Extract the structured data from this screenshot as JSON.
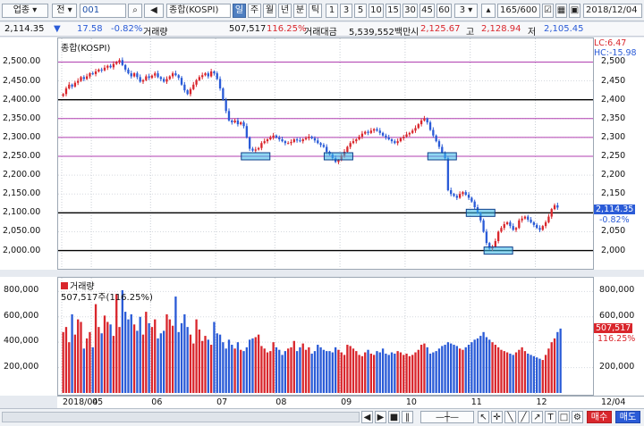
{
  "toolbar": {
    "market_select": "업종",
    "jeon_label": "전",
    "code_value": "001",
    "index_name": "종합(KOSPI)",
    "period_buttons": [
      "일",
      "주",
      "월",
      "년",
      "분",
      "틱"
    ],
    "interval_buttons": [
      "1",
      "3",
      "5",
      "10",
      "15",
      "30",
      "45",
      "60"
    ],
    "interval_select": "3",
    "count_value": "165/600",
    "date_value": "2018/12/04"
  },
  "quote": {
    "price": "2,114.35",
    "change": "17.58",
    "change_pct": "-0.82%",
    "volume_label": "거래량",
    "volume": "507,517",
    "volume_pct": "116.25%",
    "amount_label": "거래대금",
    "amount": "5,539,552백만",
    "open_label": "시",
    "open": "2,125.67",
    "high_label": "고",
    "high": "2,128.94",
    "low_label": "저",
    "low": "2,105.45"
  },
  "price_panel": {
    "title": "종합(KOSPI)",
    "lc": "LC:6.47",
    "hc": "HC:-15.98",
    "current_price": "2,114.35",
    "current_pct": "-0.82%",
    "y_ticks": [
      "2,500.00",
      "2,450.00",
      "2,400.00",
      "2,350.00",
      "2,300.00",
      "2,250.00",
      "2,200.00",
      "2,150.00",
      "2,100.00",
      "2,050.00",
      "2,000.00"
    ],
    "right_ticks": [
      "2,500",
      "2,450",
      "2,400",
      "2,350",
      "2,300",
      "2,250",
      "2,200",
      "2,150",
      "2,100",
      "2,050",
      "2,000"
    ]
  },
  "volume_panel": {
    "title": "거래량",
    "current_label": "507,517주(116.25%)",
    "current_value": "507,517",
    "current_pct": "116.25%",
    "y_ticks": [
      "800,000",
      "600,000",
      "400,000",
      "200,000"
    ],
    "right_ticks": [
      "800,000",
      "600,000",
      "400,000",
      "200,000"
    ]
  },
  "x_axis": {
    "labels": [
      "2018/04",
      "05",
      "06",
      "07",
      "08",
      "09",
      "10",
      "11",
      "12",
      "12/04"
    ]
  },
  "side_buttons": {
    "buy": "매수",
    "sell": "매도"
  },
  "colors": {
    "up": "#d9262c",
    "down": "#2a5bd7",
    "purple_line": "#b03fb0",
    "highlight": "#35b8e8"
  },
  "chart_data": {
    "type": "candlestick",
    "title": "종합(KOSPI)",
    "ylim": [
      1980,
      2520
    ],
    "reference_lines_black": [
      2400,
      2100,
      2000
    ],
    "reference_lines_purple": [
      2500,
      2350,
      2300,
      2250
    ],
    "highlight_levels": [
      2250,
      2250,
      2250,
      2100,
      2000
    ],
    "closes": [
      2415,
      2430,
      2440,
      2435,
      2445,
      2450,
      2460,
      2455,
      2462,
      2470,
      2468,
      2475,
      2480,
      2478,
      2485,
      2490,
      2486,
      2495,
      2500,
      2505,
      2492,
      2480,
      2470,
      2462,
      2470,
      2460,
      2448,
      2452,
      2462,
      2458,
      2464,
      2470,
      2460,
      2455,
      2448,
      2455,
      2462,
      2470,
      2465,
      2458,
      2440,
      2425,
      2415,
      2428,
      2440,
      2452,
      2460,
      2465,
      2470,
      2462,
      2475,
      2470,
      2455,
      2430,
      2400,
      2370,
      2345,
      2340,
      2345,
      2335,
      2340,
      2330,
      2300,
      2270,
      2265,
      2268,
      2272,
      2285,
      2290,
      2295,
      2300,
      2305,
      2300,
      2295,
      2290,
      2285,
      2285,
      2288,
      2295,
      2292,
      2290,
      2295,
      2298,
      2302,
      2298,
      2292,
      2285,
      2280,
      2275,
      2262,
      2255,
      2245,
      2235,
      2240,
      2252,
      2262,
      2275,
      2285,
      2290,
      2295,
      2302,
      2310,
      2315,
      2312,
      2318,
      2322,
      2318,
      2312,
      2305,
      2300,
      2295,
      2290,
      2285,
      2290,
      2298,
      2302,
      2308,
      2312,
      2318,
      2325,
      2335,
      2345,
      2350,
      2340,
      2320,
      2305,
      2290,
      2275,
      2260,
      2245,
      2160,
      2150,
      2145,
      2140,
      2150,
      2155,
      2148,
      2140,
      2130,
      2115,
      2100,
      2080,
      2050,
      2020,
      2005,
      2010,
      2025,
      2050,
      2060,
      2070,
      2075,
      2065,
      2055,
      2060,
      2080,
      2085,
      2090,
      2082,
      2075,
      2068,
      2060,
      2055,
      2065,
      2075,
      2090,
      2110,
      2120,
      2114
    ],
    "volumes": [
      480000,
      520000,
      400000,
      620000,
      460000,
      580000,
      560000,
      350000,
      430000,
      480000,
      360000,
      700000,
      520000,
      470000,
      610000,
      560000,
      540000,
      450000,
      780000,
      520000,
      810000,
      640000,
      580000,
      620000,
      540000,
      490000,
      600000,
      460000,
      640000,
      550000,
      520000,
      580000,
      430000,
      470000,
      490000,
      620000,
      580000,
      530000,
      760000,
      480000,
      550000,
      620000,
      520000,
      460000,
      390000,
      580000,
      500000,
      410000,
      450000,
      420000,
      380000,
      560000,
      470000,
      460000,
      400000,
      350000,
      420000,
      380000,
      350000,
      400000,
      340000,
      330000,
      360000,
      420000,
      430000,
      440000,
      460000,
      370000,
      350000,
      320000,
      330000,
      400000,
      360000,
      340000,
      300000,
      330000,
      350000,
      360000,
      410000,
      330000,
      360000,
      390000,
      340000,
      360000,
      310000,
      330000,
      380000,
      360000,
      340000,
      330000,
      330000,
      320000,
      360000,
      340000,
      320000,
      300000,
      380000,
      370000,
      350000,
      330000,
      300000,
      290000,
      320000,
      340000,
      310000,
      300000,
      330000,
      320000,
      350000,
      310000,
      300000,
      320000,
      310000,
      330000,
      320000,
      300000,
      310000,
      290000,
      300000,
      320000,
      340000,
      380000,
      390000,
      360000,
      310000,
      320000,
      330000,
      350000,
      370000,
      380000,
      400000,
      390000,
      380000,
      370000,
      350000,
      340000,
      360000,
      380000,
      400000,
      420000,
      430000,
      450000,
      480000,
      440000,
      420000,
      400000,
      380000,
      360000,
      340000,
      330000,
      320000,
      310000,
      300000,
      320000,
      340000,
      360000,
      330000,
      310000,
      300000,
      290000,
      280000,
      270000,
      260000,
      300000,
      350000,
      400000,
      430000,
      480000,
      507517
    ]
  }
}
